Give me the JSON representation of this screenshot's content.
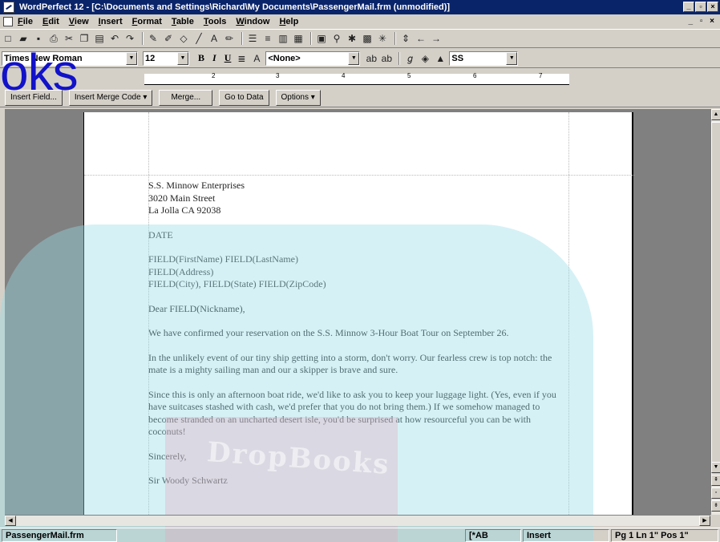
{
  "window": {
    "title": "WordPerfect 12 - [C:\\Documents and Settings\\Richard\\My Documents\\PassengerMail.frm (unmodified)]"
  },
  "menu": {
    "items": [
      "File",
      "Edit",
      "View",
      "Insert",
      "Format",
      "Table",
      "Tools",
      "Window",
      "Help"
    ]
  },
  "propbar": {
    "font": "Times New Roman",
    "size": "12",
    "style": "<None>",
    "lang": "SS"
  },
  "ruler": {
    "numbers": [
      "2",
      "3",
      "4",
      "5",
      "6",
      "7"
    ]
  },
  "merge_bar": {
    "insert_field": "Insert Field...",
    "insert_merge_code": "Insert Merge Code",
    "merge": "Merge...",
    "go_to_data": "Go to Data",
    "options": "Options"
  },
  "letter": {
    "company": "S.S. Minnow Enterprises",
    "street": "3020 Main Street",
    "city_line": "La Jolla CA 92038",
    "date": "DATE",
    "name_line": "FIELD(FirstName) FIELD(LastName)",
    "address_line": "FIELD(Address)",
    "city_state_line": "FIELD(City), FIELD(State) FIELD(ZipCode)",
    "salutation": "Dear FIELD(Nickname),",
    "para1": "We have confirmed your reservation on the S.S. Minnow 3-Hour Boat Tour on September 26.",
    "para2": "In the unlikely event of our tiny ship getting into a storm, don't worry. Our fearless crew is top notch: the mate is a mighty sailing man and our a skipper is brave and sure.",
    "para3": "Since this is only an afternoon boat ride, we'd like to ask you to keep your luggage light. (Yes, even if you have suitcases stashed with cash, we'd prefer that you do not bring them.) If we somehow managed to become stranded on an uncharted desert isle, you'd be surprised at how resourceful you can be with coconuts!",
    "closing": "Sincerely,",
    "signature": "Sir Woody Schwartz"
  },
  "watermark": {
    "corner": "oks",
    "center": "DropBooks"
  },
  "status": {
    "filename": "PassengerMail.frm",
    "mode_icons": "[*AB",
    "insert": "Insert",
    "position": "Pg 1 Ln 1\" Pos 1\""
  },
  "colors": {
    "titlebar": "#0a246a",
    "chrome": "#d4d0c8",
    "watermark_corner": "#1212c8",
    "watermark_cyan": "#96dce8"
  }
}
